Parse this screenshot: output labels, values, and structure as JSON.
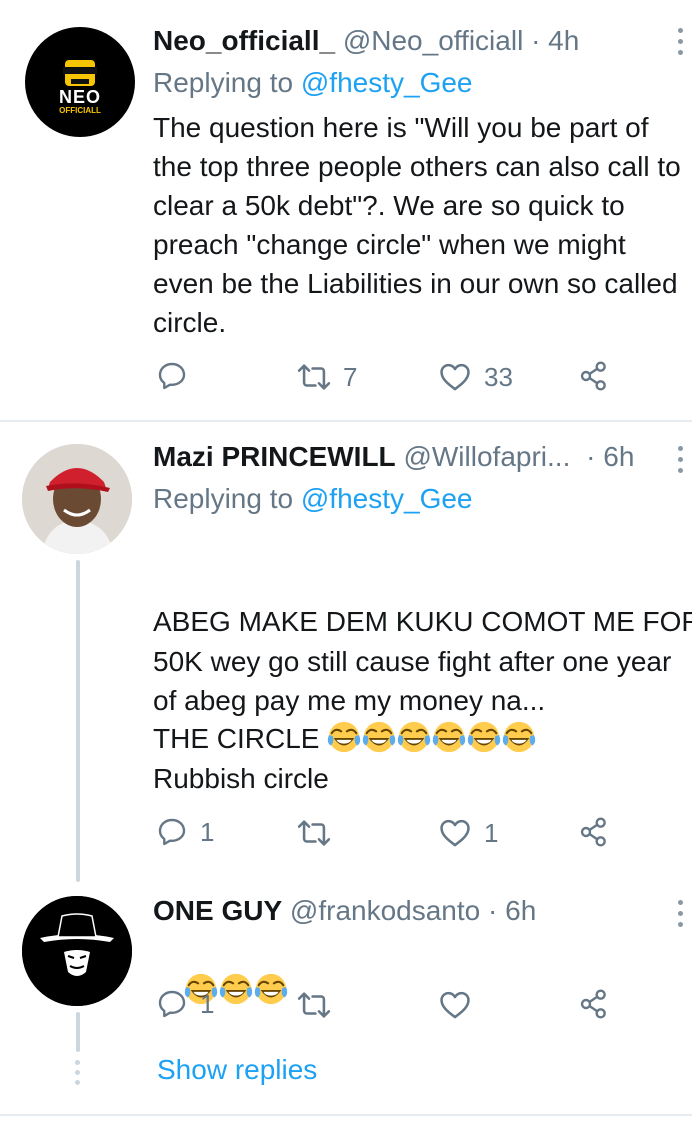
{
  "tweets": [
    {
      "name": "Neo_officiall_",
      "handle": "@Neo_officiall",
      "time": "· 4h",
      "replying_prefix": "Replying to ",
      "replying_to": "@fhesty_Gee",
      "text": "The question here is \"Will you be part of the top three people others can also call to clear a 50k debt\"?. We are so quick to preach \"change circle\" when we might even be the Liabilities in our own so called circle.",
      "replies": "",
      "retweets": "7",
      "likes": "33",
      "avatar_text": "NEO",
      "avatar_subtext": "OFFICIALL"
    },
    {
      "name": "Mazi PRINCEWILL",
      "handle": "@Willofapri...",
      "time": "· 6h",
      "replying_prefix": "Replying to ",
      "replying_to": "@fhesty_Gee",
      "text_line1": "ABEG MAKE DEM KUKU COMOT ME FOR",
      "text_line2": "THE CIRCLE",
      "text_para2": "50K wey go still cause fight after one year of abeg pay me my money na...",
      "text_para3": "Rubbish circle",
      "replies": "1",
      "retweets": "",
      "likes": "1"
    },
    {
      "name": "ONE GUY",
      "handle": "@frankodsanto",
      "time": "· 6h",
      "replies": "1",
      "retweets": "",
      "likes": ""
    }
  ],
  "show_replies": "Show replies",
  "colors": {
    "link": "#1da1f2",
    "muted": "#657786",
    "divider": "#e6ecf0",
    "thread": "#ccd6dd"
  }
}
